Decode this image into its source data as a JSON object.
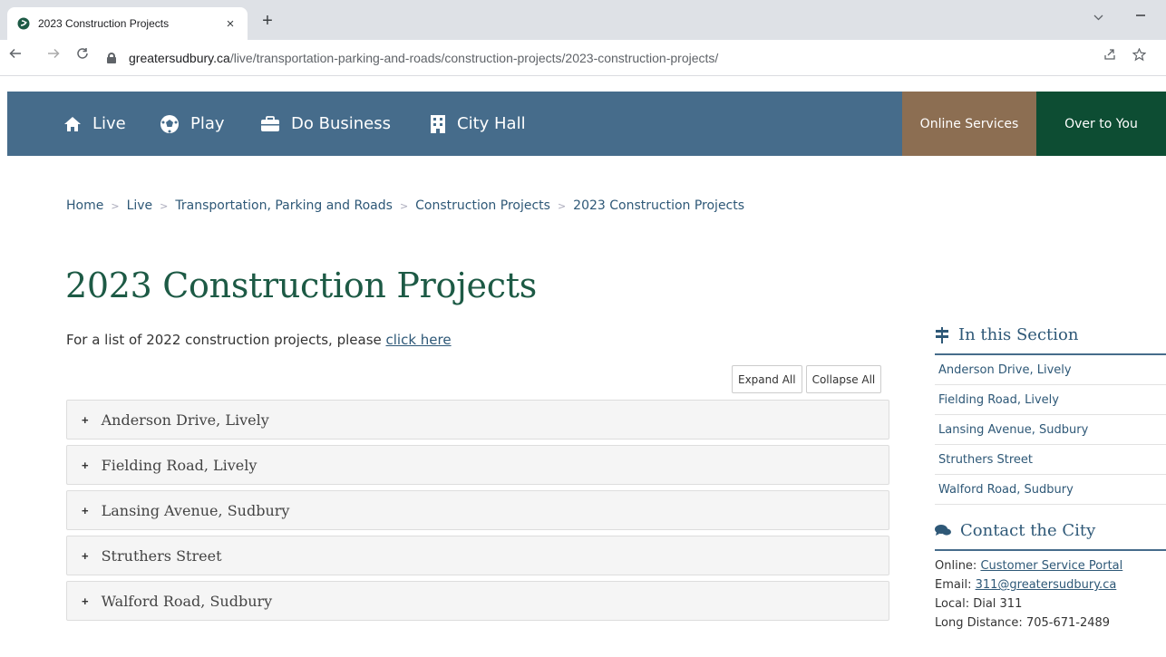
{
  "browser": {
    "tab_title": "2023 Construction Projects",
    "tab_close": "×",
    "new_tab": "+",
    "url_domain": "greatersudbury.ca",
    "url_path": "/live/transportation-parking-and-roads/construction-projects/2023-construction-projects/"
  },
  "nav": {
    "items": [
      {
        "label": "Live",
        "icon": "home-icon"
      },
      {
        "label": "Play",
        "icon": "soccer-ball-icon"
      },
      {
        "label": "Do Business",
        "icon": "briefcase-icon"
      },
      {
        "label": "City Hall",
        "icon": "building-icon"
      }
    ],
    "online_services": "Online Services",
    "over_to_you": "Over to You",
    "colors": {
      "bar": "#466c8b",
      "online_services": "#8c6e52",
      "over_to_you": "#0d4d33"
    }
  },
  "breadcrumb": {
    "items": [
      "Home",
      "Live",
      "Transportation, Parking and Roads",
      "Construction Projects",
      "2023 Construction Projects"
    ],
    "separator": ">"
  },
  "page": {
    "title": "2023 Construction Projects",
    "intro_text": "For a list of 2022 construction projects, please ",
    "intro_link": "click here"
  },
  "controls": {
    "expand_all": "Expand All",
    "collapse_all": "Collapse All"
  },
  "accordion": {
    "items": [
      {
        "label": "Anderson Drive, Lively"
      },
      {
        "label": "Fielding Road, Lively"
      },
      {
        "label": "Lansing Avenue, Sudbury"
      },
      {
        "label": "Struthers Street"
      },
      {
        "label": "Walford Road, Sudbury"
      }
    ],
    "toggle_symbol": "+"
  },
  "sidebar": {
    "section_title": "In this Section",
    "section_items": [
      "Anderson Drive, Lively",
      "Fielding Road, Lively",
      "Lansing Avenue, Sudbury",
      "Struthers Street",
      "Walford Road, Sudbury"
    ],
    "contact_title": "Contact the City",
    "contact": {
      "online_label": "Online: ",
      "online_link": "Customer Service Portal",
      "email_label": "Email: ",
      "email_link": "311@greatersudbury.ca",
      "local": "Local: Dial 311",
      "long_distance": "Long Distance: 705-671-2489"
    }
  }
}
